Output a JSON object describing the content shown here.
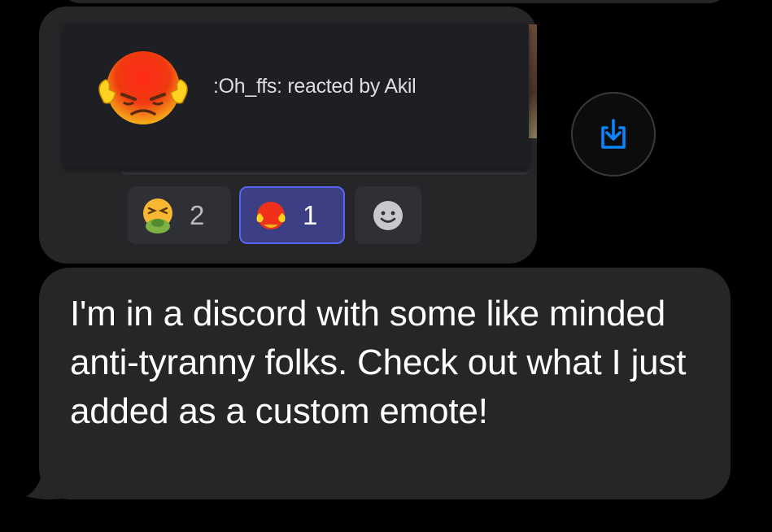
{
  "tooltip": {
    "reaction_label": ":Oh_ffs: reacted by Akil"
  },
  "reactions": [
    {
      "emoji": "nauseated-face-icon",
      "count": "2",
      "selected": false
    },
    {
      "emoji": "oh-ffs-custom-emote-icon",
      "count": "1",
      "selected": true
    },
    {
      "emoji": "add-reaction-smiley-icon",
      "count": null,
      "selected": false
    }
  ],
  "actions": {
    "save_icon": "download-arrow-icon"
  },
  "message": {
    "text": "I'm in a discord with some like minded anti-tyranny folks. Check out what I just added as a custom emote!"
  },
  "colors": {
    "bubble": "#262628",
    "selected_reaction_border": "#5865f2",
    "save_icon": "#0a84ff"
  }
}
